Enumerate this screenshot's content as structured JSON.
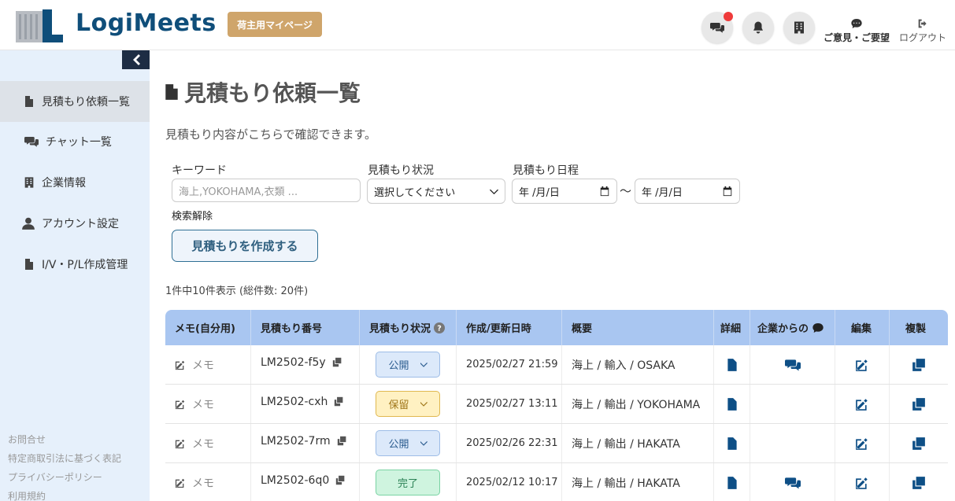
{
  "header": {
    "logo_text": "LogiMeets",
    "badge": "荷主用マイページ",
    "feedback_label": "ご意見・ご要望",
    "logout_label": "ログアウト",
    "accent_color": "#0f4e7a"
  },
  "sidebar": {
    "items": [
      {
        "label": "見積もり依頼一覧",
        "icon": "file-icon"
      },
      {
        "label": "チャット一覧",
        "icon": "chat-icon"
      },
      {
        "label": "企業情報",
        "icon": "building-icon"
      },
      {
        "label": "アカウント設定",
        "icon": "user-icon"
      },
      {
        "label": "I/V・P/L作成管理",
        "icon": "file-icon"
      }
    ],
    "footer": [
      "お問合せ",
      "特定商取引法に基づく表記",
      "プライバシーポリシー",
      "利用規約"
    ]
  },
  "main": {
    "title": "見積もり依頼一覧",
    "subtitle": "見積もり内容がこちらで確認できます。",
    "filters": {
      "keyword_label": "キーワード",
      "keyword_placeholder": "海上,YOKOHAMA,衣類 ...",
      "status_label": "見積もり状況",
      "status_value": "選択してください",
      "date_label": "見積もり日程",
      "date_from": "年 /月/日",
      "date_to": "年 /月/日",
      "tilde": "〜",
      "clear_label": "検索解除"
    },
    "create_button": "見積もりを作成する",
    "count_text": "1件中10件表示 (総件数: 20件)"
  },
  "table": {
    "headers": [
      "メモ(自分用)",
      "見積もり番号",
      "見積もり状況",
      "作成/更新日時",
      "概要",
      "詳細",
      "企業からの",
      "編集",
      "複製"
    ],
    "memo_label": "メモ",
    "rows": [
      {
        "number": "LM2502-f5y",
        "status": "公開",
        "datetime": "2025/02/27 21:59",
        "summary": "海上 / 輸入 / OSAKA",
        "chat": true
      },
      {
        "number": "LM2502-cxh",
        "status": "保留",
        "datetime": "2025/02/27 13:11",
        "summary": "海上 / 輸出 / YOKOHAMA",
        "chat": false
      },
      {
        "number": "LM2502-7rm",
        "status": "公開",
        "datetime": "2025/02/26 22:31",
        "summary": "海上 / 輸出 / HAKATA",
        "chat": false
      },
      {
        "number": "LM2502-6q0",
        "status": "完了",
        "datetime": "2025/02/12 10:17",
        "summary": "海上 / 輸出 / HAKATA",
        "chat": true
      }
    ]
  }
}
